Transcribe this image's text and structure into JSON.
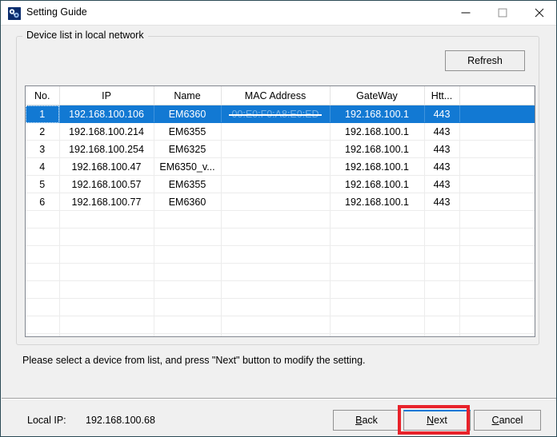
{
  "window": {
    "title": "Setting Guide",
    "icon": "app-icon",
    "controls": {
      "minimize": "minimize-icon",
      "maximize": "maximize-icon",
      "close": "close-icon"
    }
  },
  "groupbox": {
    "title": "Device list in local network"
  },
  "toolbar": {
    "refresh_label": "Refresh"
  },
  "table": {
    "columns": [
      "No.",
      "IP",
      "Name",
      "MAC Address",
      "GateWay",
      "Htt..."
    ],
    "rows": [
      {
        "no": "1",
        "ip": "192.168.100.106",
        "name": "EM6360",
        "mac": "00:E0:F0:A8:E0:ED",
        "mac_redacted": true,
        "gateway": "192.168.100.1",
        "http": "443",
        "selected": true
      },
      {
        "no": "2",
        "ip": "192.168.100.214",
        "name": "EM6355",
        "mac": "",
        "mac_redacted": false,
        "gateway": "192.168.100.1",
        "http": "443",
        "selected": false
      },
      {
        "no": "3",
        "ip": "192.168.100.254",
        "name": "EM6325",
        "mac": "",
        "mac_redacted": false,
        "gateway": "192.168.100.1",
        "http": "443",
        "selected": false
      },
      {
        "no": "4",
        "ip": "192.168.100.47",
        "name": "EM6350_v...",
        "mac": "",
        "mac_redacted": false,
        "gateway": "192.168.100.1",
        "http": "443",
        "selected": false
      },
      {
        "no": "5",
        "ip": "192.168.100.57",
        "name": "EM6355",
        "mac": "",
        "mac_redacted": false,
        "gateway": "192.168.100.1",
        "http": "443",
        "selected": false
      },
      {
        "no": "6",
        "ip": "192.168.100.77",
        "name": "EM6360",
        "mac": "",
        "mac_redacted": false,
        "gateway": "192.168.100.1",
        "http": "443",
        "selected": false
      }
    ],
    "empty_row_count": 9,
    "selection_color": "#1279d3"
  },
  "hint": {
    "text": "Please select a device from list, and press \"Next\" button to modify the setting."
  },
  "footer": {
    "local_ip_label": "Local IP:",
    "local_ip_value": "192.168.100.68",
    "buttons": {
      "back": {
        "accel": "B",
        "rest": "ack"
      },
      "next": {
        "accel": "N",
        "rest": "ext",
        "focused": true
      },
      "cancel": {
        "accel": "C",
        "rest": "ancel"
      }
    }
  },
  "annotation": {
    "color": "#e8222a",
    "target": "next-button"
  }
}
